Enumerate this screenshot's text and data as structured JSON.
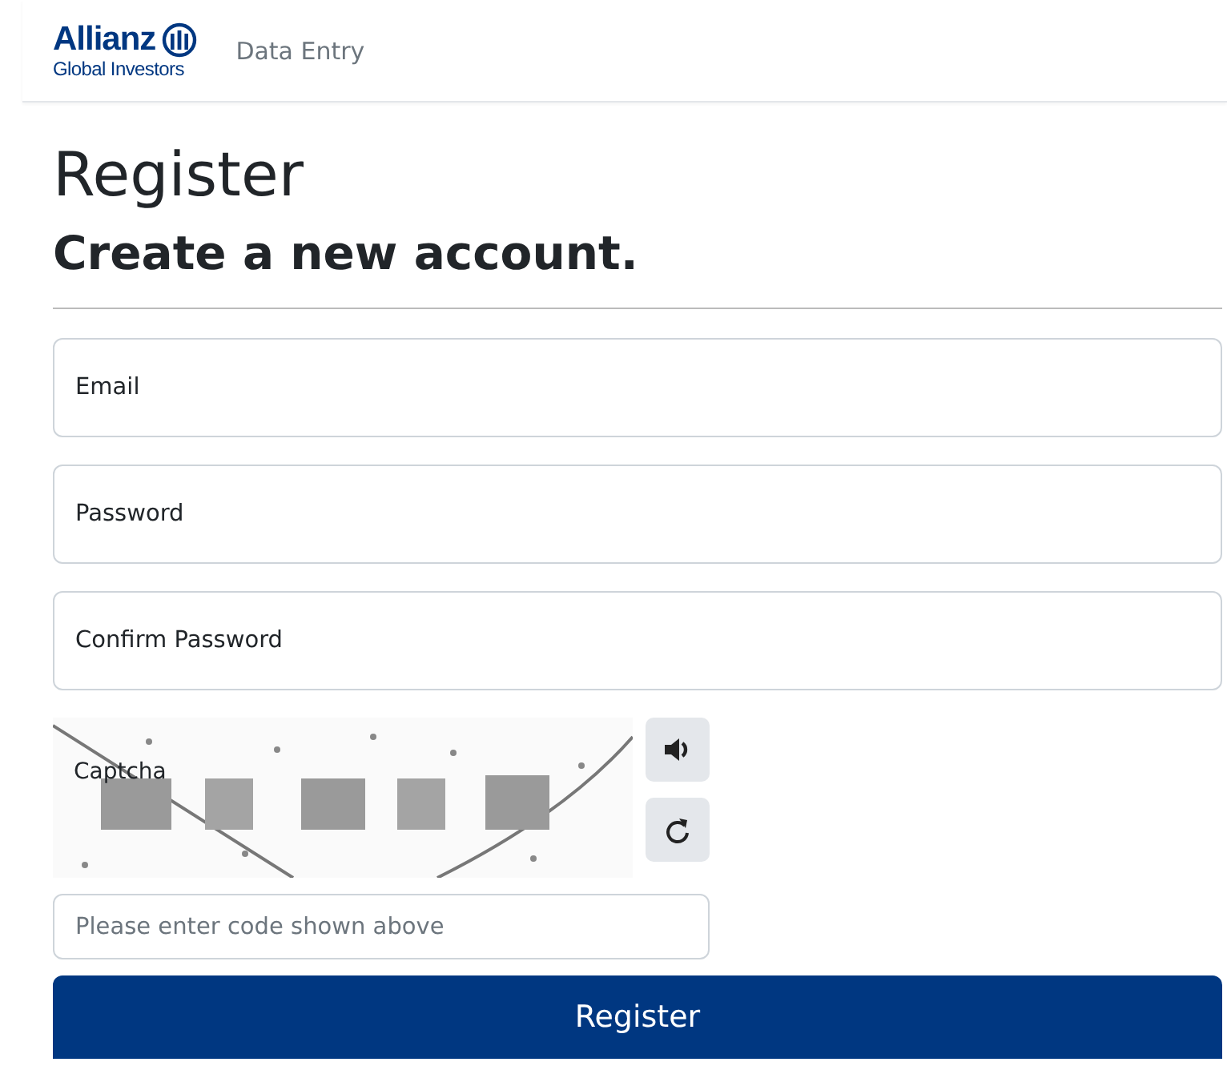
{
  "header": {
    "brand": {
      "name": "Allianz",
      "subtitle": "Global Investors"
    },
    "nav": [
      {
        "label": "Data Entry"
      }
    ]
  },
  "title": "Register",
  "subtitle": "Create a new account.",
  "fields": [
    {
      "kind": "floating",
      "placeholder": "Email"
    },
    {
      "kind": "floating",
      "placeholder": "Password"
    },
    {
      "kind": "floating",
      "placeholder": "Confirm Password"
    }
  ],
  "captcha": {
    "label": "Captcha",
    "input": {
      "placeholder": "Please enter code shown above"
    }
  },
  "submit": {
    "label": "Register"
  }
}
